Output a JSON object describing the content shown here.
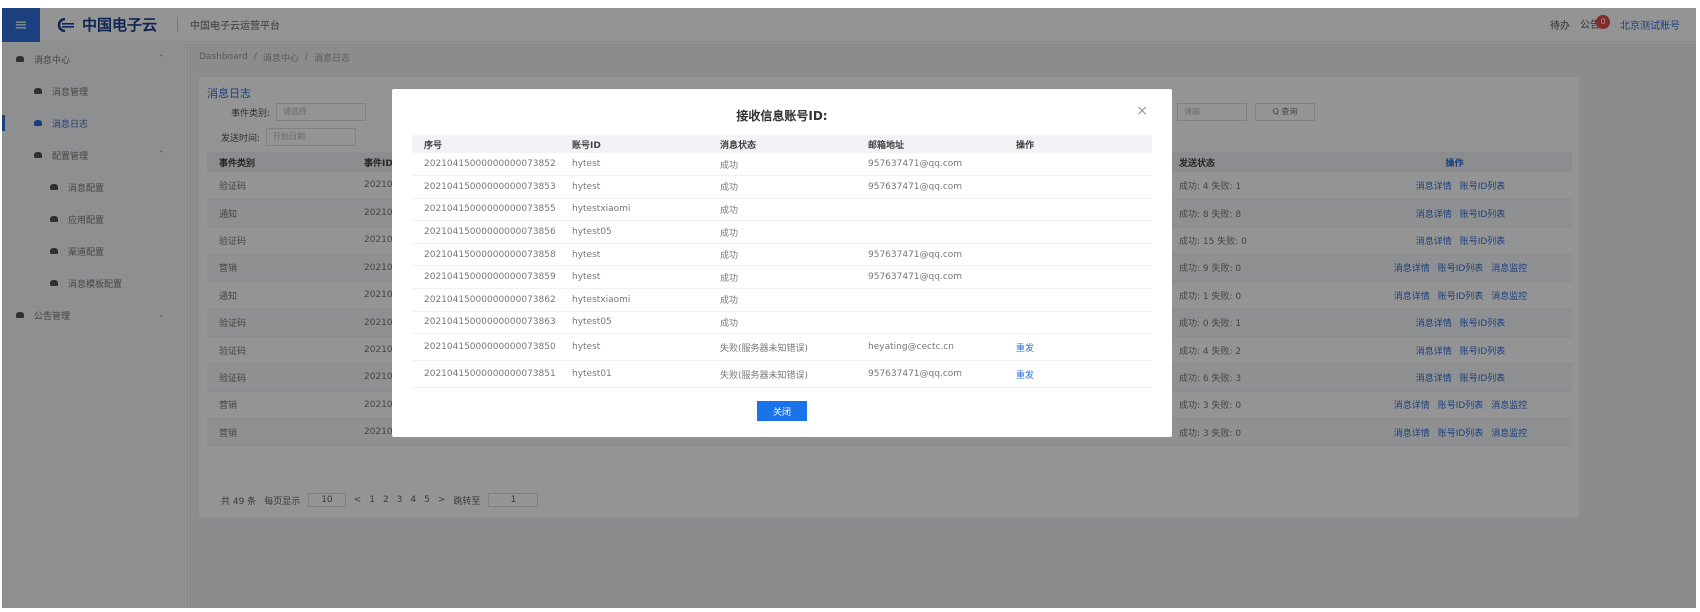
{
  "header": {
    "brand": "中国电子云",
    "platform": "中国电子云运营平台",
    "todo": "待办",
    "notice": "公告",
    "notice_count": "0",
    "account": "北京测试账号"
  },
  "sidebar": {
    "items": [
      {
        "label": "消息中心",
        "level": 0
      },
      {
        "label": "消息管理",
        "level": 1
      },
      {
        "label": "消息日志",
        "level": 1
      },
      {
        "label": "配置管理",
        "level": 1
      },
      {
        "label": "消息配置",
        "level": 2
      },
      {
        "label": "应用配置",
        "level": 2
      },
      {
        "label": "渠道配置",
        "level": 2
      },
      {
        "label": "消息模板配置",
        "level": 2
      },
      {
        "label": "公告管理",
        "level": 0
      }
    ]
  },
  "breadcrumb": [
    "Dashboard",
    "消息中心",
    "消息日志"
  ],
  "page": {
    "title": "消息日志",
    "event_type_label": "事件类别:",
    "event_type_placeholder": "请选择",
    "send_time_label": "发送时间:",
    "send_time_placeholder": "开始日期",
    "search_placeholder": "请输",
    "query_button": "Q 查询"
  },
  "bg_table": {
    "headers": [
      "事件类别",
      "事件ID",
      "发送状态",
      "操作"
    ],
    "rows": [
      {
        "type": "验证码",
        "id": "202104",
        "status": "成功: 4  失败: 1",
        "ops": [
          "消息详情",
          "账号ID列表"
        ]
      },
      {
        "type": "通知",
        "id": "202104",
        "status": "成功: 8  失败: 8",
        "ops": [
          "消息详情",
          "账号ID列表"
        ]
      },
      {
        "type": "验证码",
        "id": "202104",
        "status": "成功: 15  失败: 0",
        "ops": [
          "消息详情",
          "账号ID列表"
        ]
      },
      {
        "type": "营销",
        "id": "202104",
        "status": "成功: 9  失败: 0",
        "ops": [
          "消息详情",
          "账号ID列表",
          "消息监控"
        ]
      },
      {
        "type": "通知",
        "id": "202104",
        "status": "成功: 1  失败: 0",
        "ops": [
          "消息详情",
          "账号ID列表",
          "消息监控"
        ]
      },
      {
        "type": "验证码",
        "id": "202104",
        "status": "成功: 0  失败: 1",
        "ops": [
          "消息详情",
          "账号ID列表"
        ]
      },
      {
        "type": "验证码",
        "id": "202104",
        "status": "成功: 4  失败: 2",
        "ops": [
          "消息详情",
          "账号ID列表"
        ]
      },
      {
        "type": "验证码",
        "id": "202104",
        "status": "成功: 6  失败: 3",
        "ops": [
          "消息详情",
          "账号ID列表"
        ]
      },
      {
        "type": "营销",
        "id": "202104",
        "status": "成功: 3  失败: 0",
        "ops": [
          "消息详情",
          "账号ID列表",
          "消息监控"
        ]
      },
      {
        "type": "营销",
        "id": "202104",
        "status": "成功: 3  失败: 0",
        "ops": [
          "消息详情",
          "账号ID列表",
          "消息监控"
        ]
      }
    ]
  },
  "pager": {
    "total": "共 49 条",
    "per_page": "每页显示",
    "per_page_value": "10",
    "pages": [
      "1",
      "2",
      "3",
      "4",
      "5"
    ],
    "jump_label": "跳转至",
    "jump_value": "1"
  },
  "modal": {
    "title": "接收信息账号ID:",
    "close_icon": "×",
    "headers": [
      "序号",
      "账号ID",
      "消息状态",
      "邮箱地址",
      "操作"
    ],
    "rows": [
      {
        "seq": "20210415000000000073852",
        "account": "hytest",
        "status": "成功",
        "email": "957637471@qq.com",
        "op": ""
      },
      {
        "seq": "20210415000000000073853",
        "account": "hytest",
        "status": "成功",
        "email": "957637471@qq.com",
        "op": ""
      },
      {
        "seq": "20210415000000000073855",
        "account": "hytestxiaomi",
        "status": "成功",
        "email": "",
        "op": ""
      },
      {
        "seq": "20210415000000000073856",
        "account": "hytest05",
        "status": "成功",
        "email": "",
        "op": ""
      },
      {
        "seq": "20210415000000000073858",
        "account": "hytest",
        "status": "成功",
        "email": "957637471@qq.com",
        "op": ""
      },
      {
        "seq": "20210415000000000073859",
        "account": "hytest",
        "status": "成功",
        "email": "957637471@qq.com",
        "op": ""
      },
      {
        "seq": "20210415000000000073862",
        "account": "hytestxiaomi",
        "status": "成功",
        "email": "",
        "op": ""
      },
      {
        "seq": "20210415000000000073863",
        "account": "hytest05",
        "status": "成功",
        "email": "",
        "op": ""
      },
      {
        "seq": "20210415000000000073850",
        "account": "hytest",
        "status": "失败(服务器未知错误)",
        "email": "heyating@cectc.cn",
        "op": "重发"
      },
      {
        "seq": "20210415000000000073851",
        "account": "hytest01",
        "status": "失败(服务器未知错误)",
        "email": "957637471@qq.com",
        "op": "重发"
      }
    ],
    "close_button": "关闭"
  },
  "colors": {
    "primary": "#2f6fd8",
    "button": "#1a73e8",
    "badge": "#e34a4a"
  }
}
